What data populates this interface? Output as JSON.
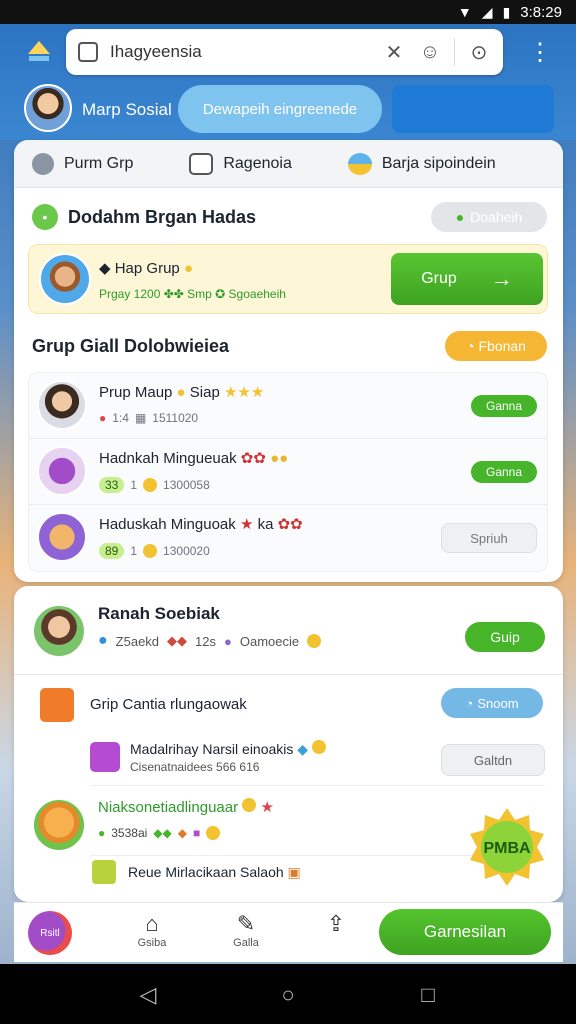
{
  "status": {
    "time": "3:8:29"
  },
  "search": {
    "query": "Ihagyeensia"
  },
  "profile": {
    "name": "Marp Sosial",
    "pill_label": "Dewapeih eingreenede"
  },
  "categories": [
    {
      "label": "Purm Grp",
      "icon": "people-icon"
    },
    {
      "label": "Ragenoia",
      "icon": "chat-icon"
    },
    {
      "label": "Barja sipoindein",
      "icon": "globe-icon"
    }
  ],
  "section1": {
    "title": "Dodahm Brgan Hadas",
    "pill": "Doaheih"
  },
  "featured": {
    "title": "Hap Grup",
    "meta": "Prgay 1200 ✤✤ Smp ✪ Sgoaeheih",
    "button": "Grup"
  },
  "section2": {
    "title": "Grup Giall Dolobwieiea",
    "pill": "Fbonan"
  },
  "rows": [
    {
      "title": "Prup Maup",
      "extra": "Siap",
      "count": "1:4",
      "num": "1511020",
      "button": "Ganna"
    },
    {
      "title": "Hadnkah Mingueuak",
      "badge": "33",
      "count": "1",
      "num": "1300058",
      "button": "Ganna"
    },
    {
      "title": "Haduskah Minguoak",
      "extra": "ka",
      "badge": "89",
      "count": "1",
      "num": "1300020",
      "button": "Spriuh"
    }
  ],
  "person": {
    "name": "Ranah Soebiak",
    "meta1": "Z5aekd",
    "meta2": "12s",
    "meta3": "Oamoecie",
    "button": "Guip"
  },
  "group": {
    "title": "Grip Cantia rlungaowak",
    "button": "Snoom"
  },
  "sub": {
    "title": "Madalrihay Narsil einoakis",
    "subtitle": "Cisenatnaidees 566 616",
    "button": "Galtdn"
  },
  "community": {
    "title": "Niaksonetiadlinguaar",
    "meta": "3538ai",
    "badge": "PMBA"
  },
  "resource": {
    "title": "Reue Mirlacikaan Salaoh"
  },
  "bottom_nav": {
    "item1": "Gsiba",
    "item2": "Galla",
    "cta": "Garnesilan",
    "avatar_text": "Rsitl"
  }
}
